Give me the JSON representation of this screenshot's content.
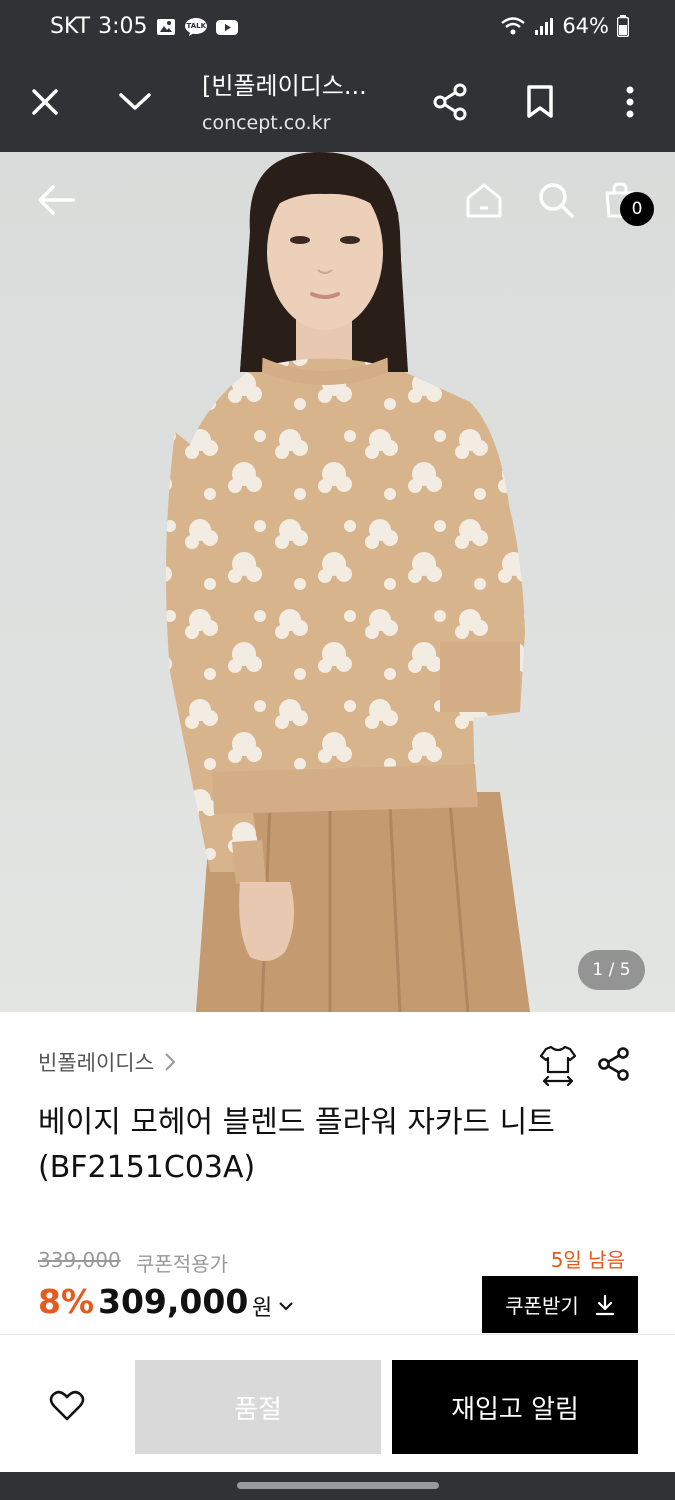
{
  "status_bar": {
    "carrier": "SKT",
    "time": "3:05",
    "notification_icons": [
      "gallery-icon",
      "kakaotalk-icon",
      "youtube-icon"
    ],
    "talk_badge": "TALK",
    "battery": "64%"
  },
  "browser": {
    "title": "[빈폴레이디스...",
    "url": "concept.co.kr"
  },
  "hero": {
    "cart_count": "0",
    "page_indicator": "1 / 5"
  },
  "product": {
    "brand": "빈폴레이디스",
    "title": "베이지 모헤어 블렌드 플라워 자카드 니트 (BF2151C03A)",
    "original_price": "339,000",
    "coupon_label": "쿠폰적용가",
    "days_left": "5일 남음",
    "discount": "8%",
    "sale_price": "309,000",
    "currency": "원",
    "coupon_button": "쿠폰받기"
  },
  "bottom_bar": {
    "soldout_label": "품절",
    "restock_label": "재입고 알림"
  },
  "colors": {
    "accent": "#e65a1e",
    "system_bar": "#303236",
    "button_dark": "#000000",
    "button_disabled": "#d9d9d9",
    "sweater": "#d8b48c",
    "skirt": "#c49a70"
  }
}
